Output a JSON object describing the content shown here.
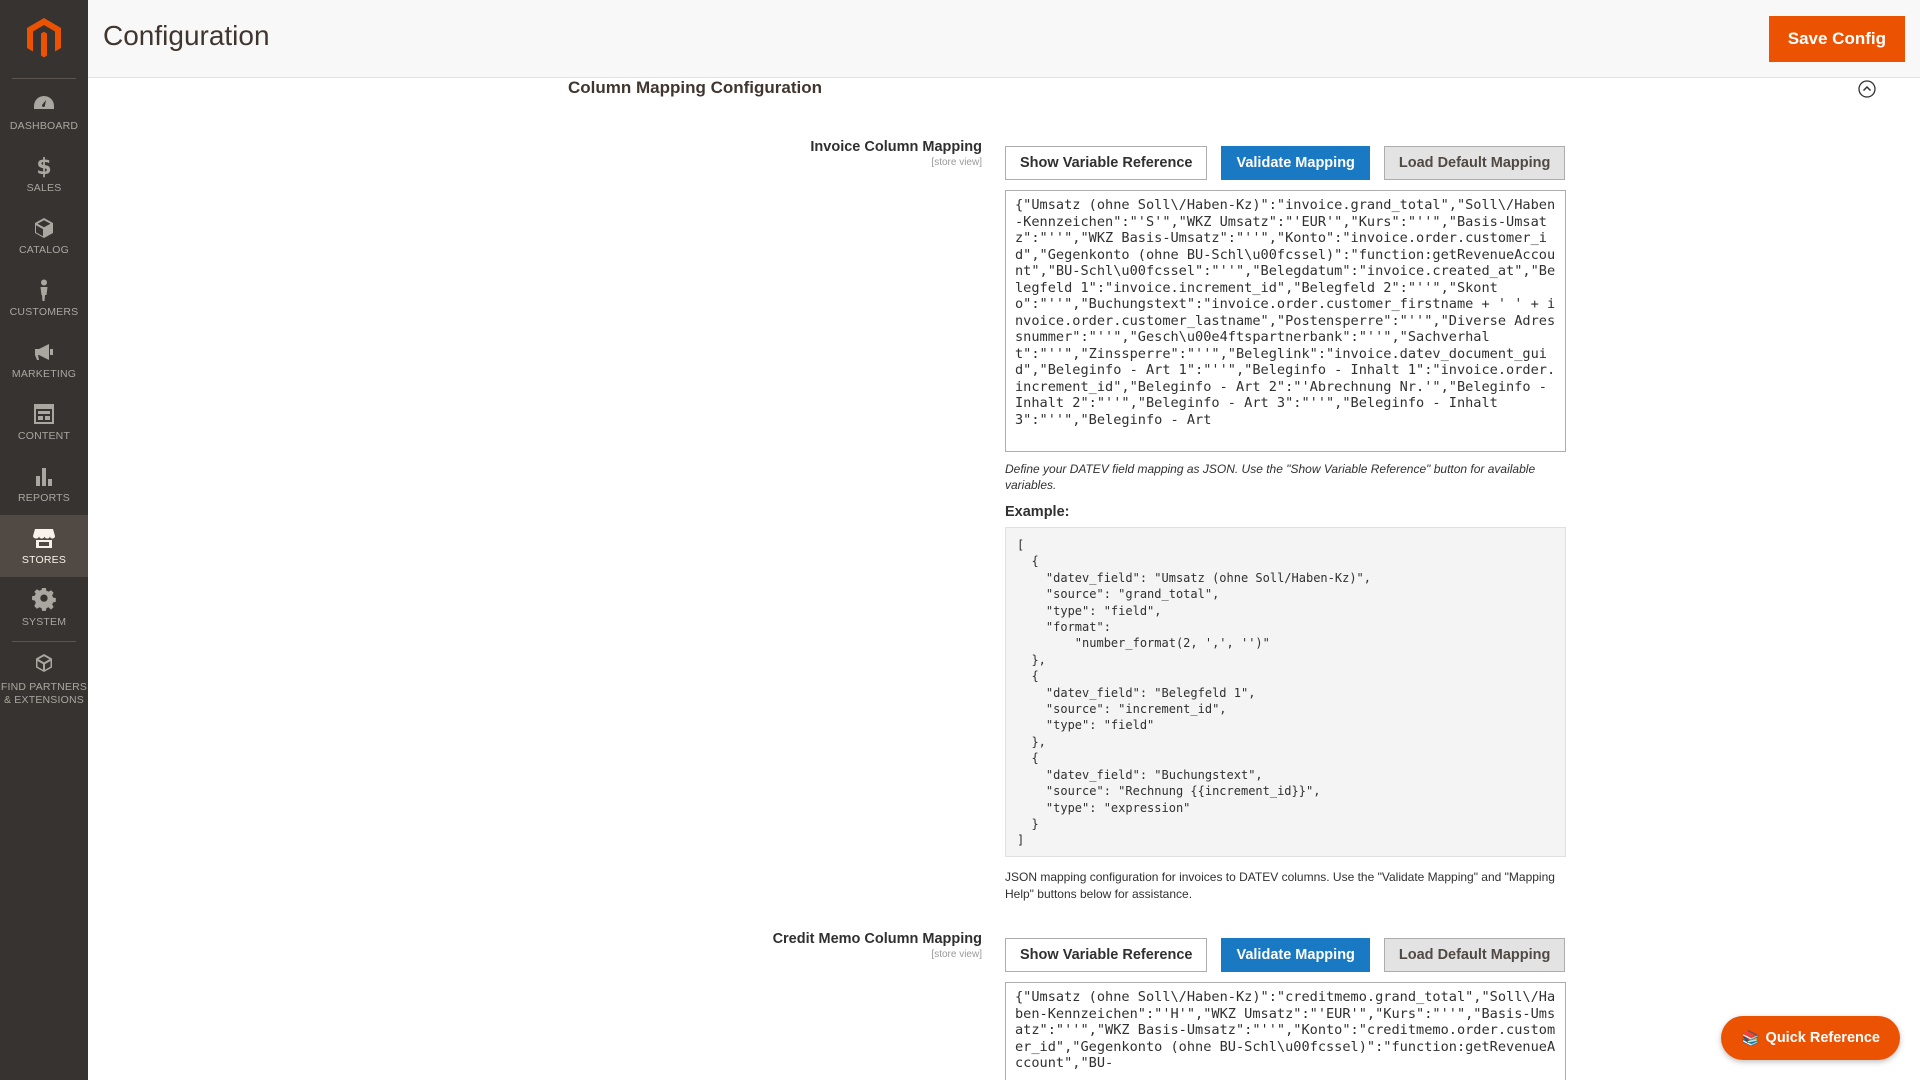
{
  "sidebar": {
    "items": [
      {
        "label": "DASHBOARD",
        "icon": "dashboard-icon"
      },
      {
        "label": "SALES",
        "icon": "dollar-icon"
      },
      {
        "label": "CATALOG",
        "icon": "box-icon"
      },
      {
        "label": "CUSTOMERS",
        "icon": "person-icon"
      },
      {
        "label": "MARKETING",
        "icon": "megaphone-icon"
      },
      {
        "label": "CONTENT",
        "icon": "layout-icon"
      },
      {
        "label": "REPORTS",
        "icon": "bar-chart-icon"
      },
      {
        "label": "STORES",
        "icon": "storefront-icon",
        "active": true
      },
      {
        "label": "SYSTEM",
        "icon": "gear-icon"
      },
      {
        "label": "FIND PARTNERS & EXTENSIONS",
        "icon": "cubes-icon"
      }
    ]
  },
  "header": {
    "title": "Configuration",
    "save_label": "Save Config"
  },
  "section": {
    "title": "Column Mapping Configuration"
  },
  "invoice": {
    "label": "Invoice Column Mapping",
    "scope": "[store view]",
    "buttons": {
      "show_ref": "Show Variable Reference",
      "validate": "Validate Mapping",
      "load_default": "Load Default Mapping"
    },
    "value": "{\"Umsatz (ohne Soll\\/Haben-Kz)\":\"invoice.grand_total\",\"Soll\\/Haben-Kennzeichen\":\"'S'\",\"WKZ Umsatz\":\"'EUR'\",\"Kurs\":\"''\",\"Basis-Umsatz\":\"''\",\"WKZ Basis-Umsatz\":\"''\",\"Konto\":\"invoice.order.customer_id\",\"Gegenkonto (ohne BU-Schl\\u00fcssel)\":\"function:getRevenueAccount\",\"BU-Schl\\u00fcssel\":\"''\",\"Belegdatum\":\"invoice.created_at\",\"Belegfeld 1\":\"invoice.increment_id\",\"Belegfeld 2\":\"''\",\"Skonto\":\"''\",\"Buchungstext\":\"invoice.order.customer_firstname + ' ' + invoice.order.customer_lastname\",\"Postensperre\":\"''\",\"Diverse Adressnummer\":\"''\",\"Gesch\\u00e4ftspartnerbank\":\"''\",\"Sachverhalt\":\"''\",\"Zinssperre\":\"''\",\"Beleglink\":\"invoice.datev_document_guid\",\"Beleginfo - Art 1\":\"''\",\"Beleginfo - Inhalt 1\":\"invoice.order.increment_id\",\"Beleginfo - Art 2\":\"'Abrechnung Nr.'\",\"Beleginfo - Inhalt 2\":\"''\",\"Beleginfo - Art 3\":\"''\",\"Beleginfo - Inhalt 3\":\"''\",\"Beleginfo - Art",
    "note": "Define your DATEV field mapping as JSON. Use the \"Show Variable Reference\" button for available variables.",
    "example_title": "Example:",
    "example": "[\n  {\n    \"datev_field\": \"Umsatz (ohne Soll/Haben-Kz)\",\n    \"source\": \"grand_total\",\n    \"type\": \"field\",\n    \"format\":\n        \"number_format(2, ',', '')\"\n  },\n  {\n    \"datev_field\": \"Belegfeld 1\",\n    \"source\": \"increment_id\",\n    \"type\": \"field\"\n  },\n  {\n    \"datev_field\": \"Buchungstext\",\n    \"source\": \"Rechnung {{increment_id}}\",\n    \"type\": \"expression\"\n  }\n]",
    "comment": "JSON mapping configuration for invoices to DATEV columns. Use the \"Validate Mapping\" and \"Mapping Help\" buttons below for assistance."
  },
  "creditmemo": {
    "label": "Credit Memo Column Mapping",
    "scope": "[store view]",
    "buttons": {
      "show_ref": "Show Variable Reference",
      "validate": "Validate Mapping",
      "load_default": "Load Default Mapping"
    },
    "value": "{\"Umsatz (ohne Soll\\/Haben-Kz)\":\"creditmemo.grand_total\",\"Soll\\/Haben-Kennzeichen\":\"'H'\",\"WKZ Umsatz\":\"'EUR'\",\"Kurs\":\"''\",\"Basis-Umsatz\":\"''\",\"WKZ Basis-Umsatz\":\"''\",\"Konto\":\"creditmemo.order.customer_id\",\"Gegenkonto (ohne BU-Schl\\u00fcssel)\":\"function:getRevenueAccount\",\"BU-"
  },
  "quick_reference": {
    "label": "Quick Reference",
    "icon": "books-icon"
  }
}
